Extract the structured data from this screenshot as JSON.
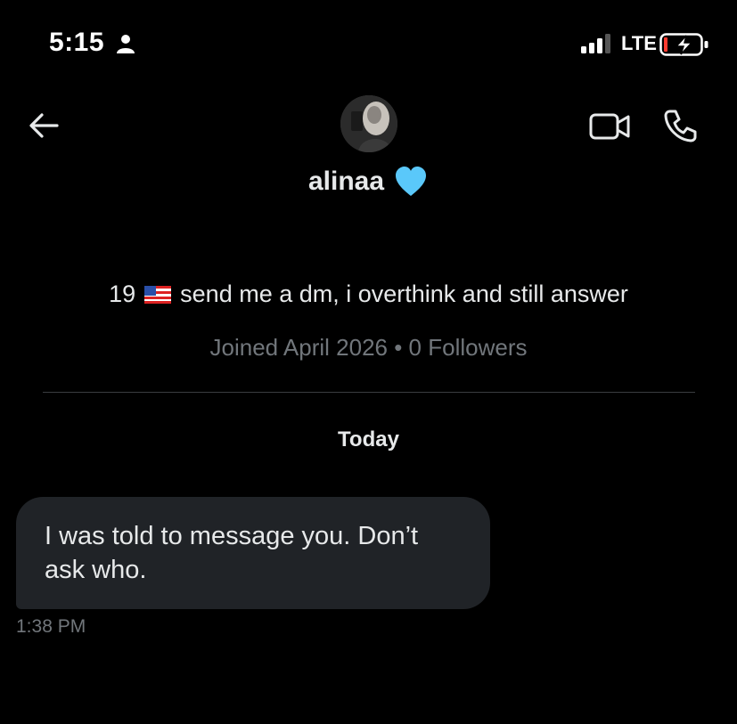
{
  "status_bar": {
    "time": "5:15",
    "network": "LTE",
    "icons": [
      "person-icon",
      "signal-icon",
      "battery-charging-icon"
    ]
  },
  "header": {
    "back_icon": "arrow-left-icon",
    "video_icon": "video-call-icon",
    "phone_icon": "phone-call-icon",
    "name": "alinaa",
    "name_emoji": "blue-heart-icon",
    "heart_color": "#5ac8fa"
  },
  "profile": {
    "bio_prefix": "19",
    "bio_flag": "us-flag-icon",
    "bio_text": "send me a dm, i overthink and still answer",
    "meta": "Joined April 2026 • 0 Followers"
  },
  "conversation": {
    "date_label": "Today",
    "messages": [
      {
        "text": "I was told to message you. Don’t ask who.",
        "time": "1:38 PM"
      }
    ]
  },
  "colors": {
    "background": "#000000",
    "bubble": "#202327",
    "text": "#e7e9ea",
    "muted": "#71767b",
    "battery_low": "#ff3b30"
  }
}
